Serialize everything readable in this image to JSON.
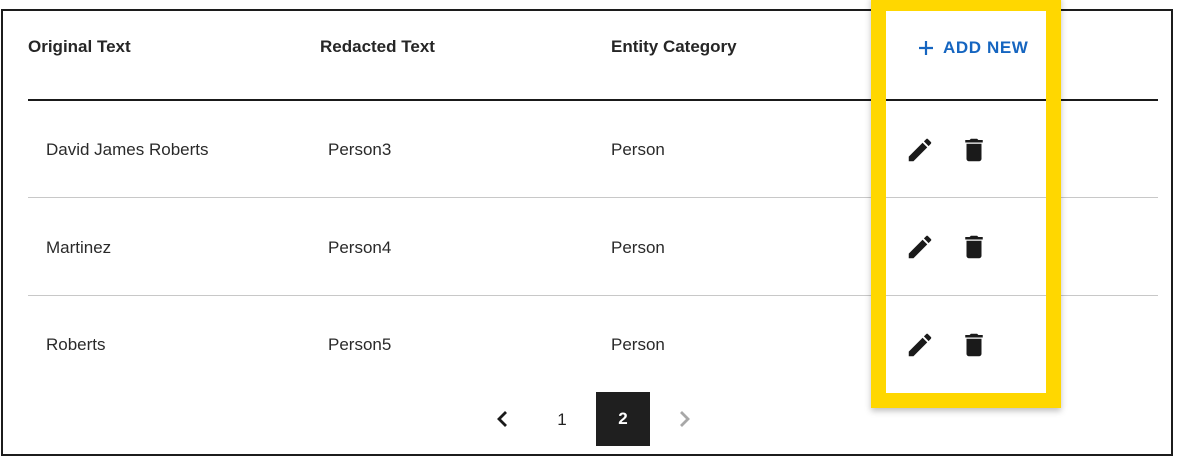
{
  "table": {
    "headers": [
      "Original Text",
      "Redacted Text",
      "Entity Category"
    ],
    "add_new_label": "ADD NEW",
    "rows": [
      {
        "original": "David James Roberts",
        "redacted": "Person3",
        "category": "Person"
      },
      {
        "original": "Martinez",
        "redacted": "Person4",
        "category": "Person"
      },
      {
        "original": "Roberts",
        "redacted": "Person5",
        "category": "Person"
      }
    ],
    "row_actions": [
      "pencil-icon",
      "trash-icon"
    ]
  },
  "pagination": {
    "pages": [
      "1",
      "2"
    ],
    "current_page": "2"
  },
  "colors": {
    "accent_link": "#1565c0",
    "highlight": "#ffd700",
    "current_page_bg": "#1f1f1f"
  }
}
